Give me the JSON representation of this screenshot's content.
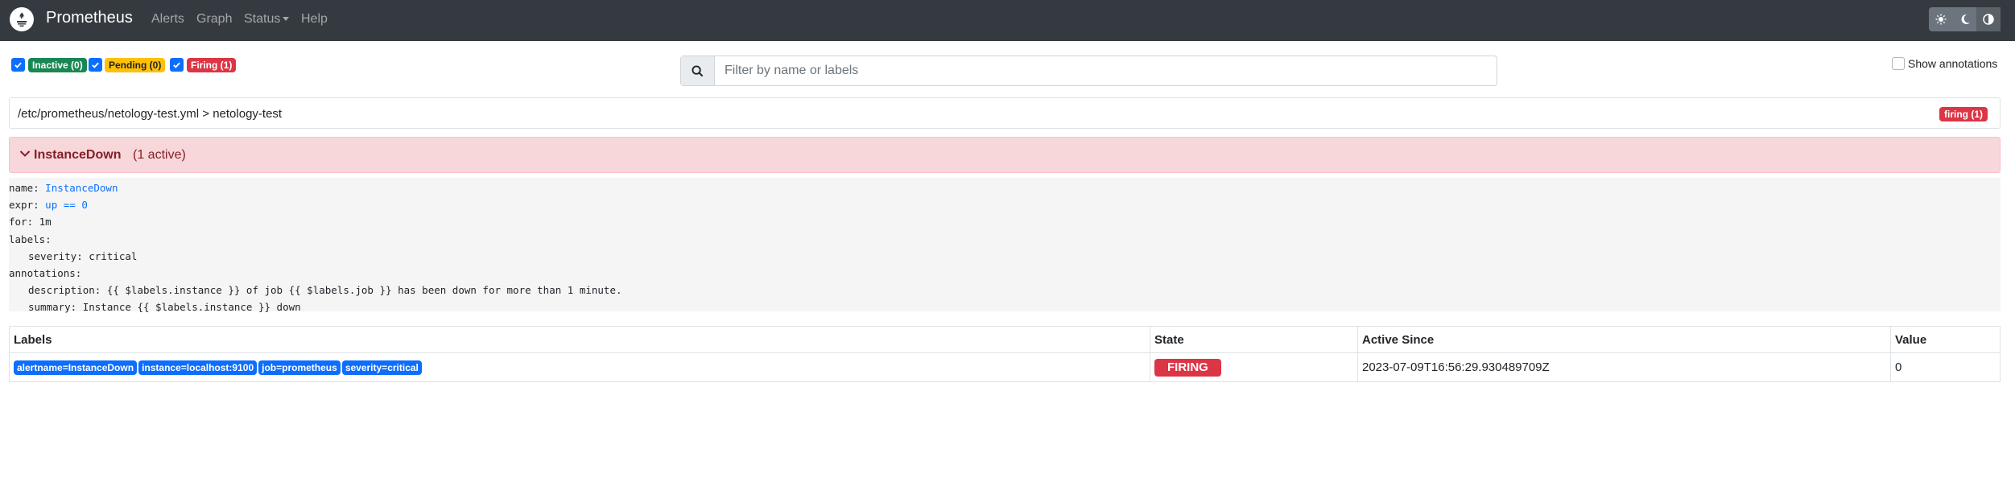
{
  "navbar": {
    "brand": "Prometheus",
    "links": {
      "alerts": "Alerts",
      "graph": "Graph",
      "status": "Status",
      "help": "Help"
    },
    "theme_buttons": [
      "light-theme-icon",
      "dark-theme-icon",
      "auto-theme-icon"
    ]
  },
  "filters": {
    "inactive": "Inactive (0)",
    "pending": "Pending (0)",
    "firing": "Firing (1)"
  },
  "search": {
    "placeholder": "Filter by name or labels",
    "value": ""
  },
  "show_annotations": "Show annotations",
  "group": {
    "title": "/etc/prometheus/netology-test.yml > netology-test",
    "badge": "firing (1)"
  },
  "alert": {
    "name": "InstanceDown",
    "active": "(1 active)"
  },
  "rule": {
    "name_key": "name:",
    "name_val": "InstanceDown",
    "expr_key": "expr:",
    "expr_val": "up == 0",
    "for": "for: 1m",
    "labels": "labels:",
    "severity": "severity: critical",
    "annotations": "annotations:",
    "description": "description: {{ $labels.instance }} of job {{ $labels.job }} has been down for more than 1 minute.",
    "summary": "summary: Instance {{ $labels.instance }} down"
  },
  "table": {
    "headers": {
      "labels": "Labels",
      "state": "State",
      "active_since": "Active Since",
      "value": "Value"
    },
    "row": {
      "labels": [
        "alertname=InstanceDown",
        "instance=localhost:9100",
        "job=prometheus",
        "severity=critical"
      ],
      "state": "FIRING",
      "active_since": "2023-07-09T16:56:29.930489709Z",
      "value": "0"
    }
  },
  "colors": {
    "navbar": "#343a40",
    "primary": "#0d6efd",
    "danger": "#dc3545",
    "success": "#198754",
    "warning": "#ffc107",
    "alert_bg": "#f8d7da"
  }
}
